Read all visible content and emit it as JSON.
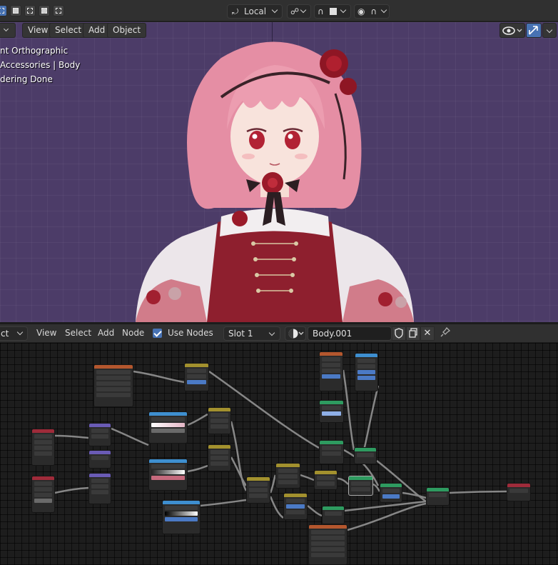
{
  "top_header": {
    "transform_orientation": "Local"
  },
  "viewport": {
    "menus": {
      "view": "View",
      "select": "Select",
      "add": "Add",
      "object": "Object"
    },
    "overlay_lines": [
      "nt Orthographic",
      "Accessories | Body",
      "dering Done"
    ],
    "background_color": "#4c3c68"
  },
  "node_editor": {
    "menus": {
      "view": "View",
      "select": "Select",
      "add": "Add",
      "node": "Node"
    },
    "editor_type_partial": "ct",
    "use_nodes_label": "Use Nodes",
    "use_nodes_checked": true,
    "slot_label": "Slot 1",
    "material_name": "Body.001"
  },
  "colors": {
    "header_bg": "#303030",
    "accent_blue": "#4772b3",
    "node_canvas_bg": "#1d1d1d"
  }
}
